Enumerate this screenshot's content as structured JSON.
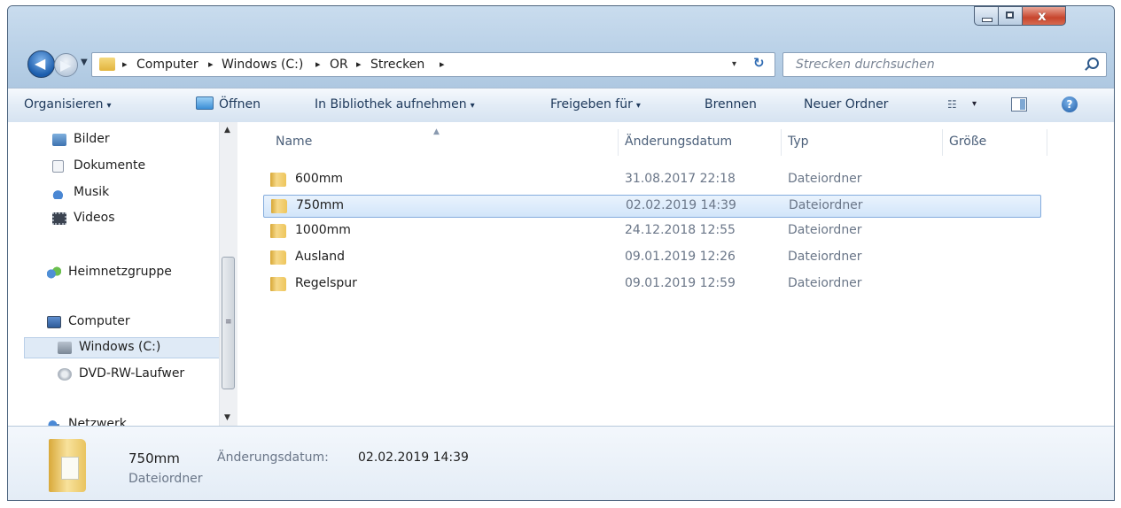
{
  "window": {
    "close_glyph": "x"
  },
  "nav": {
    "back_glyph": "◀",
    "forward_glyph": "▶",
    "recent_glyph": "▼"
  },
  "address": {
    "crumbs": [
      "Computer",
      "Windows (C:)",
      "OR",
      "Strecken"
    ],
    "separator": "▸",
    "dropdown_glyph": "▾",
    "refresh_glyph": "↻"
  },
  "search": {
    "placeholder": "Strecken durchsuchen"
  },
  "commandbar": {
    "organize": "Organisieren",
    "open": "Öffnen",
    "include_library": "In Bibliothek aufnehmen",
    "share": "Freigeben für",
    "burn": "Brennen",
    "new_folder": "Neuer Ordner",
    "caret": "▾",
    "view_glyph": "☷",
    "help_glyph": "?"
  },
  "nav_pane": {
    "items": [
      {
        "label": "Bilder",
        "icon": "pictures-icon"
      },
      {
        "label": "Dokumente",
        "icon": "documents-icon"
      },
      {
        "label": "Musik",
        "icon": "music-icon"
      },
      {
        "label": "Videos",
        "icon": "videos-icon"
      },
      {
        "label": "Heimnetzgruppe",
        "icon": "homegroup-icon"
      },
      {
        "label": "Computer",
        "icon": "computer-icon"
      },
      {
        "label": "Windows (C:)",
        "icon": "drive-icon"
      },
      {
        "label": "DVD-RW-Laufwer",
        "icon": "dvd-drive-icon"
      },
      {
        "label": "Netzwerk",
        "icon": "network-icon"
      }
    ],
    "selected": "Windows (C:)",
    "scroll_up": "▲",
    "scroll_down": "▼",
    "scroll_grip": "≡"
  },
  "columns": {
    "name": "Name",
    "date": "Änderungsdatum",
    "type": "Typ",
    "size": "Größe",
    "sort_glyph": "▲"
  },
  "files": [
    {
      "name": "600mm",
      "date": "31.08.2017 22:18",
      "type": "Dateiordner"
    },
    {
      "name": "750mm",
      "date": "02.02.2019 14:39",
      "type": "Dateiordner",
      "selected": true
    },
    {
      "name": "1000mm",
      "date": "24.12.2018 12:55",
      "type": "Dateiordner"
    },
    {
      "name": "Ausland",
      "date": "09.01.2019 12:26",
      "type": "Dateiordner"
    },
    {
      "name": "Regelspur",
      "date": "09.01.2019 12:59",
      "type": "Dateiordner"
    }
  ],
  "details": {
    "name": "750mm",
    "type": "Dateiordner",
    "date_label": "Änderungsdatum:",
    "date_value": "02.02.2019 14:39"
  }
}
